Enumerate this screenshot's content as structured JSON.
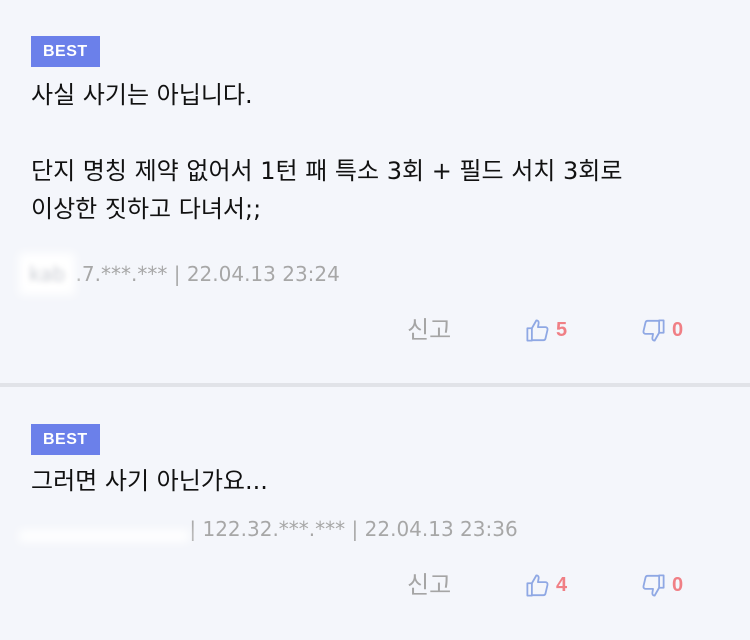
{
  "comments": [
    {
      "badge": "BEST",
      "text": "사실 사기는 아닙니다.\n\n단지 명칭 제약 없어서 1턴 패 특소 3회 + 필드 서치 3회로\n이상한 짓하고 다녀서;;",
      "nickname": "kab",
      "ip": ".7.***.***",
      "date": "22.04.13 23:24",
      "report_label": "신고",
      "likes": "5",
      "dislikes": "0"
    },
    {
      "badge": "BEST",
      "text": "그러면 사기 아닌가요...",
      "nickname": "",
      "ip": "122.32.***.***",
      "date": "22.04.13 23:36",
      "report_label": "신고",
      "likes": "4",
      "dislikes": "0"
    }
  ],
  "colors": {
    "badge_bg": "#6b80ea",
    "count": "#f07f85",
    "icon": "#8fa8e4",
    "background": "#f4f6fb"
  },
  "icons": {
    "like": "thumbs-up-icon",
    "dislike": "thumbs-down-icon"
  }
}
